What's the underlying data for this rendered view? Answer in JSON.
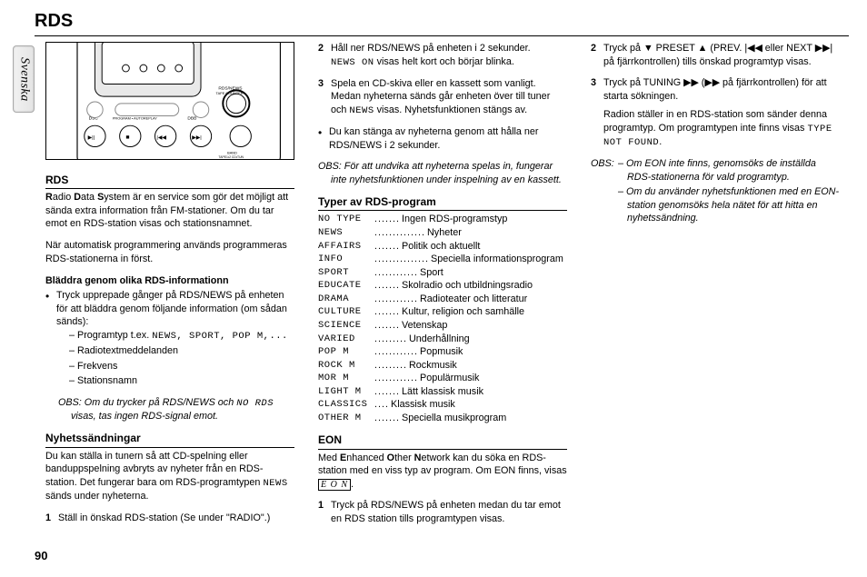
{
  "page_number": "90",
  "header_title": "RDS",
  "language_tab": "Svenska",
  "rds": {
    "heading": "RDS",
    "para": "adio Data System är en service som gör det möjligt att sända extra information från FM-stationer. Om du tar emot en RDS-station visas  och stationsnamnet.",
    "para1_a": "adio ",
    "para1_b": "ata ",
    "para1_c": "ystem är en service som gör det möjligt att sända extra information från FM-stationer. Om du tar emot en RDS-station visas ",
    "para1_d": " och stationsnamnet.",
    "rds_sym": "",
    "para2": "När automatisk programmering används programmeras RDS-stationerna in först.",
    "sub": "Bläddra genom olika RDS-informationn",
    "bul1": "Tryck upprepade gånger på RDS/NEWS på enheten för att bläddra genom följande information (om sådan sänds):",
    "d1a": "– Programtyp t.ex. ",
    "d1b_seg": "NEWS, SPORT, POP M,...",
    "d2": "– Radiotextmeddelanden",
    "d3": "– Frekvens",
    "d4": "– Stationsnamn",
    "note_a": "OBS: Om du trycker på RDS/NEWS och ",
    "note_seg": "NO RDS",
    "note_b": " visas, tas ingen RDS-signal emot."
  },
  "ny": {
    "heading": "Nyhetssändningar",
    "intro_a": "Du kan ställa in tunern så att CD-spelning eller banduppspelning avbryts av nyheter från en RDS-station. Det fungerar bara om RDS-programtypen ",
    "intro_seg": "NEWS",
    "intro_b": " sänds under nyheterna.",
    "s1": "Ställ in önskad RDS-station (Se under \"RADIO\".)",
    "s2a": "Håll ner RDS/NEWS på enheten i 2 sekunder.",
    "s2_seg": "NEWS ON",
    "s2b": " visas helt kort och  börjar blinka.",
    "s3a": "Spela en CD-skiva eller en kassett som vanligt. Medan nyheterna sänds går enheten över till tuner och ",
    "s3_seg": "NEWS",
    "s3b": " visas. Nyhetsfunktionen stängs av.",
    "bul": "Du kan stänga av nyheterna genom att hålla ner RDS/NEWS i 2 sekunder.",
    "note": "OBS: För att undvika att nyheterna spelas in, fungerar inte nyhetsfunktionen under inspelning av en kassett."
  },
  "types": {
    "heading": "Typer av RDS-program",
    "rows": [
      {
        "code": "NO TYPE",
        "dots": ".......",
        "desc": "Ingen RDS-programstyp"
      },
      {
        "code": "NEWS",
        "dots": "..............",
        "desc": "Nyheter"
      },
      {
        "code": "AFFAIRS",
        "dots": ".......",
        "desc": "Politik och aktuellt"
      },
      {
        "code": "INFO",
        "dots": "...............",
        "desc": "Speciella informationsprogram"
      },
      {
        "code": "SPORT",
        "dots": "............",
        "desc": "Sport"
      },
      {
        "code": "EDUCATE",
        "dots": ".......",
        "desc": "Skolradio och utbildningsradio"
      },
      {
        "code": "DRAMA",
        "dots": "............",
        "desc": "Radioteater och litteratur"
      },
      {
        "code": "CULTURE",
        "dots": ".......",
        "desc": "Kultur, religion och samhälle"
      },
      {
        "code": "SCIENCE",
        "dots": ".......",
        "desc": "Vetenskap"
      },
      {
        "code": "VARIED",
        "dots": ".........",
        "desc": "Underhållning"
      },
      {
        "code": "POP M",
        "dots": "............",
        "desc": "Popmusik"
      },
      {
        "code": "ROCK M",
        "dots": ".........",
        "desc": "Rockmusik"
      },
      {
        "code": "MOR M",
        "dots": "............",
        "desc": "Populärmusik"
      },
      {
        "code": "LIGHT M",
        "dots": ".......",
        "desc": "Lätt klassisk musik"
      },
      {
        "code": "CLASSICS",
        "dots": "....",
        "desc": "Klassisk musik"
      },
      {
        "code": "OTHER M",
        "dots": ".......",
        "desc": "Speciella musikprogram"
      }
    ]
  },
  "eon": {
    "heading": "EON",
    "intro_a": "Med ",
    "intro_b": "nhanced ",
    "intro_c": "ther ",
    "intro_d": "etwork kan du söka en RDS-station med en viss typ av program. Om EON finns, visas ",
    "box": "E O N",
    "intro_e": ".",
    "s1": "Tryck på RDS/NEWS på enheten medan du tar emot en RDS station tills programtypen visas.",
    "s2": "Tryck på ▼ PRESET ▲ (PREV. |◀◀ eller NEXT ▶▶| på fjärrkontrollen) tills önskad programtyp visas.",
    "s3a": "Tryck på TUNING ▶▶ (▶▶ på fjärrkontrollen) för att starta sökningen.",
    "s3b": "Radion ställer in en RDS-station som sänder denna programtyp. Om programtypen inte finns visas ",
    "s3_seg": "TYPE NOT FOUND",
    "s3c": ".",
    "note_h": "OBS:",
    "note1": "– Om EON inte finns, genomsöks de inställda RDS-stationerna för vald programtyp.",
    "note2": "– Om du använder nyhetsfunktionen med en EON-station genomsöks hela nätet för att hitta en nyhetssändning."
  }
}
